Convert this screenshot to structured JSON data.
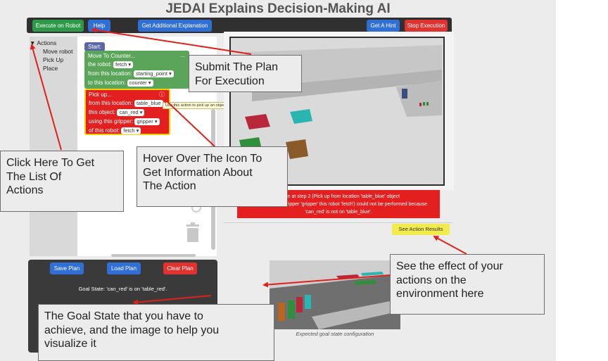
{
  "title": "JEDAI Explains Decision-Making AI",
  "toolbar": {
    "execute": "Execute on Robot",
    "help": "Help",
    "explanation": "Get Additional Explanation",
    "hint": "Get A Hint",
    "stop": "Stop Execution"
  },
  "actions_tree": {
    "root": "Actions",
    "items": [
      "Move robot",
      "Pick Up",
      "Place"
    ]
  },
  "blocks": {
    "start": "Start:",
    "move": {
      "title": "Move To Counter...",
      "dots": "...",
      "robot_label": "the robot:",
      "robot_value": "fetch",
      "from_label": "from this location:",
      "from_value": "starting_point",
      "to_label": "to this location:",
      "to_value": "counter"
    },
    "pick": {
      "title": "Pick up...",
      "info": "ⓘ",
      "from_label": "from this location:",
      "from_value": "table_blue",
      "object_label": "this object:",
      "object_value": "can_red",
      "gripper_label": "using this gripper:",
      "gripper_value": "gripper",
      "robot_label": "of this robot:",
      "robot_value": "fetch"
    },
    "tooltip": "Use this action to pick up an object from a location using the gripper."
  },
  "error_message": {
    "line1": "action at step 2 (Pick up from location 'table_blue' object",
    "line2": "'can_red' using gripper 'gripper' this robot 'fetch') could not be performed because",
    "line3": "'can_red' is not on 'table_blue'."
  },
  "see_action_results": "See Action Results",
  "plan_buttons": {
    "save": "Save Plan",
    "load": "Load Plan",
    "clear": "Clear Plan"
  },
  "goal_state": "Goal State: 'can_red' is on 'table_red'.",
  "goal_caption": "Expected goal state configuration",
  "callouts": {
    "submit": [
      "Submit The Plan",
      "For Execution"
    ],
    "actions_list": [
      "Click Here To Get",
      "The List Of",
      "Actions"
    ],
    "hover": [
      "Hover Over The Icon To",
      "Get Information About",
      "The Action"
    ],
    "effect": [
      "See the effect of your",
      "actions on the",
      "environment here"
    ],
    "goal": [
      "The Goal State that you have to",
      "achieve, and the image to help you",
      "visualize it"
    ]
  },
  "colors": {
    "toolbar_bg": "#303030",
    "execute_green": "#2e9a49",
    "button_blue": "#2f6fd6",
    "stop_red": "#e0332f",
    "block_green": "#5ba55b",
    "block_red": "#e41f1f",
    "start_block": "#5b67a5",
    "annotation_arrow": "#e0201a",
    "results_yellow": "#f3ea4e"
  }
}
